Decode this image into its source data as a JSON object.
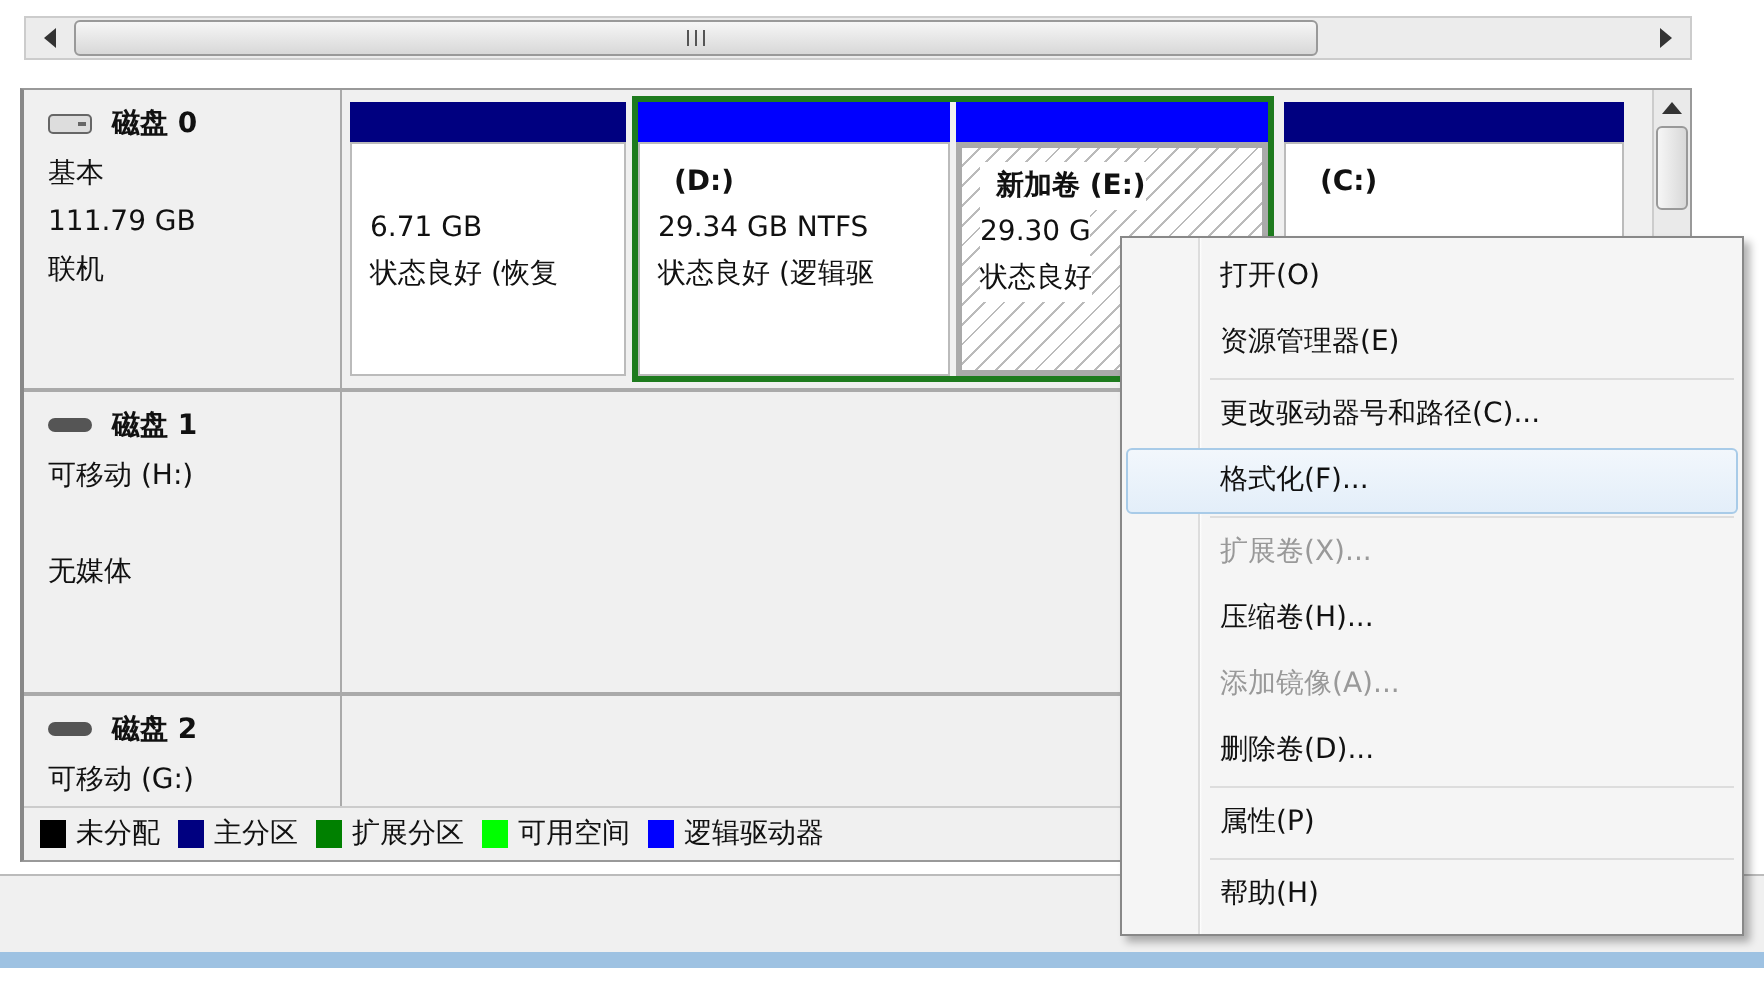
{
  "disks": [
    {
      "name": "磁盘 0",
      "kind": "fixed",
      "lines": [
        "基本",
        "111.79 GB",
        "联机"
      ],
      "partitions": [
        {
          "kind": "primary",
          "selected": false,
          "lines": [
            "6.71 GB",
            "状态良好 (恢复"
          ]
        },
        {
          "kind": "extended",
          "children": [
            {
              "kind": "logical",
              "selected": false,
              "title": "(D:)",
              "lines": [
                "29.34 GB NTFS",
                "状态良好 (逻辑驱"
              ]
            },
            {
              "kind": "logical",
              "selected": true,
              "title": "新加卷  (E:)",
              "lines": [
                "29.30 G",
                "状态良好"
              ]
            }
          ]
        },
        {
          "kind": "primary",
          "selected": false,
          "title": "(C:)"
        }
      ]
    },
    {
      "name": "磁盘 1",
      "kind": "removable",
      "lines": [
        "可移动 (H:)"
      ],
      "media_status": "无媒体"
    },
    {
      "name": "磁盘 2",
      "kind": "removable",
      "lines": [
        "可移动 (G:)"
      ]
    }
  ],
  "legend": [
    {
      "label": "未分配",
      "color": "#000000"
    },
    {
      "label": "主分区",
      "color": "#000080"
    },
    {
      "label": "扩展分区",
      "color": "#008000"
    },
    {
      "label": "可用空间",
      "color": "#00ff00"
    },
    {
      "label": "逻辑驱动器",
      "color": "#0000ff"
    }
  ],
  "context_menu": [
    [
      {
        "label": "打开(O)",
        "disabled": false,
        "selected": false
      },
      {
        "label": "资源管理器(E)",
        "disabled": false,
        "selected": false
      }
    ],
    [
      {
        "label": "更改驱动器号和路径(C)...",
        "disabled": false,
        "selected": false
      },
      {
        "label": "格式化(F)...",
        "disabled": false,
        "selected": true
      }
    ],
    [
      {
        "label": "扩展卷(X)...",
        "disabled": true,
        "selected": false
      },
      {
        "label": "压缩卷(H)...",
        "disabled": false,
        "selected": false
      },
      {
        "label": "添加镜像(A)...",
        "disabled": true,
        "selected": false
      },
      {
        "label": "删除卷(D)...",
        "disabled": false,
        "selected": false
      }
    ],
    [
      {
        "label": "属性(P)",
        "disabled": false,
        "selected": false
      }
    ],
    [
      {
        "label": "帮助(H)",
        "disabled": false,
        "selected": false
      }
    ]
  ]
}
